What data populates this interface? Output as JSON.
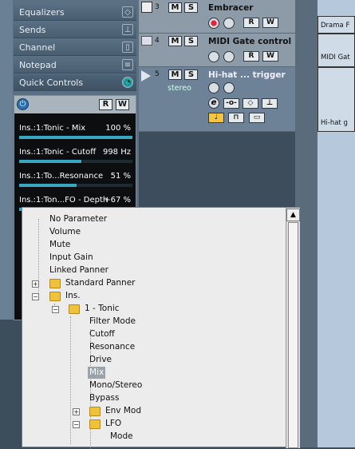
{
  "inspector": {
    "sections": [
      {
        "label": "Equalizers",
        "icon": "eq-diamond-icon"
      },
      {
        "label": "Sends",
        "icon": "sends-icon"
      },
      {
        "label": "Channel",
        "icon": "channel-icon"
      },
      {
        "label": "Notepad",
        "icon": "notepad-icon"
      },
      {
        "label": "Quick Controls",
        "icon": "quick-controls-icon"
      }
    ],
    "qc": {
      "r": "R",
      "w": "W",
      "rows": [
        {
          "label": "Ins.:1:Tonic - Mix",
          "value": "100 %",
          "level": 1.0
        },
        {
          "label": "Ins.:1:Tonic - Cutoff",
          "value": "998 Hz",
          "level": 0.55
        },
        {
          "label": "Ins.:1:To...Resonance",
          "value": "51 %",
          "level": 0.51
        },
        {
          "label": "Ins.:1:Ton...FO - Depth",
          "value": "+67 %",
          "level": 0.83
        }
      ]
    }
  },
  "tracks": [
    {
      "num": "3",
      "name": "Embracer",
      "m": "M",
      "s": "S",
      "r": "R",
      "w": "W"
    },
    {
      "num": "4",
      "name": "MIDI Gate control",
      "m": "M",
      "s": "S",
      "r": "R",
      "w": "W"
    },
    {
      "num": "5",
      "name": "Hi-hat ... trigger",
      "m": "M",
      "s": "S",
      "sub": "stereo",
      "e": "e"
    }
  ],
  "lanes": {
    "clips": [
      "Drama F",
      "MIDI Gat",
      "Hi-hat g"
    ]
  },
  "tree": {
    "items": [
      {
        "label": "No Parameter"
      },
      {
        "label": "Volume"
      },
      {
        "label": "Mute"
      },
      {
        "label": "Input Gain"
      },
      {
        "label": "Linked Panner"
      },
      {
        "label": "Standard Panner"
      },
      {
        "label": "Ins."
      },
      {
        "label": "1 - Tonic"
      },
      {
        "label": "Filter Mode"
      },
      {
        "label": "Cutoff"
      },
      {
        "label": "Resonance"
      },
      {
        "label": "Drive"
      },
      {
        "label": "Mix",
        "selected": true
      },
      {
        "label": "Mono/Stereo"
      },
      {
        "label": "Bypass"
      },
      {
        "label": "Env Mod"
      },
      {
        "label": "LFO"
      },
      {
        "label": "Mode"
      }
    ],
    "plus": "+",
    "minus": "−"
  },
  "colors": {
    "accent": "#3aa7c0",
    "highlight": "#9aa3ab"
  }
}
